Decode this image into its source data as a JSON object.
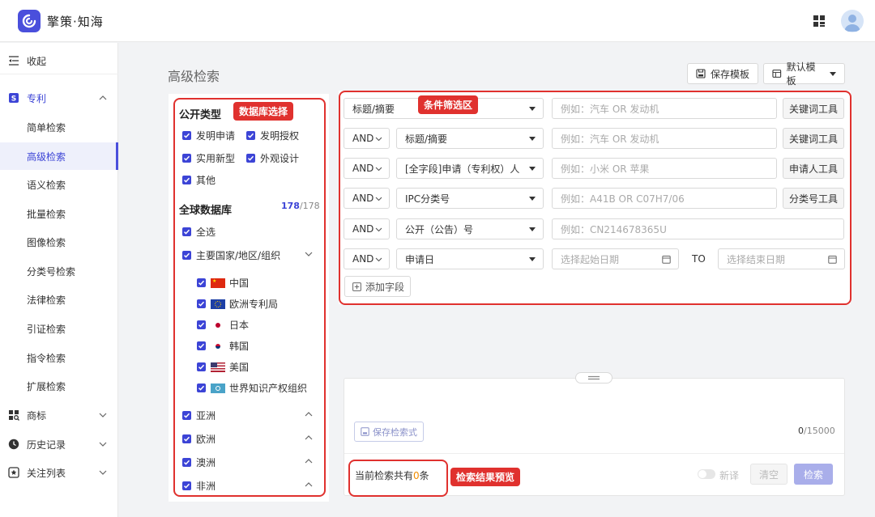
{
  "app": {
    "title": "擎策·知海"
  },
  "sidebar": {
    "collapse_label": "收起",
    "patent": {
      "label": "专利",
      "items": [
        "简单检索",
        "高级检索",
        "语义检索",
        "批量检索",
        "图像检索",
        "分类号检索",
        "法律检索",
        "引证检索",
        "指令检索",
        "扩展检索"
      ],
      "active": "高级检索"
    },
    "trademark_label": "商标",
    "history_label": "历史记录",
    "watchlist_label": "关注列表"
  },
  "page": {
    "title": "高级检索",
    "save_template_label": "保存模板",
    "default_template_label": "默认模板"
  },
  "database": {
    "pub_type_title": "公开类型",
    "pub_types": [
      "发明申请",
      "发明授权",
      "实用新型",
      "外观设计",
      "其他"
    ],
    "global_db_title": "全球数据库",
    "count_selected": "178",
    "count_total": "/178",
    "select_all_label": "全选",
    "major_group_label": "主要国家/地区/组织",
    "countries": [
      "中国",
      "欧洲专利局",
      "日本",
      "韩国",
      "美国",
      "世界知识产权组织"
    ],
    "regions": [
      "亚洲",
      "欧洲",
      "澳洲",
      "非洲"
    ]
  },
  "conditions": {
    "rows": [
      {
        "op": "",
        "field": "标题/摘要",
        "placeholder": "例如：汽车  OR 发动机",
        "tool": "关键词工具"
      },
      {
        "op": "AND",
        "field": "标题/摘要",
        "placeholder": "例如：汽车  OR 发动机",
        "tool": "关键词工具"
      },
      {
        "op": "AND",
        "field": "[全字段]申请（专利权）人",
        "placeholder": "例如：小米 OR 苹果",
        "tool": "申请人工具"
      },
      {
        "op": "AND",
        "field": "IPC分类号",
        "placeholder": "例如：A41B OR  C07H7/06",
        "tool": "分类号工具"
      },
      {
        "op": "AND",
        "field": "公开（公告）号",
        "placeholder": "例如：CN214678365U",
        "tool": ""
      },
      {
        "op": "AND",
        "field": "申请日",
        "placeholder": "选择起始日期",
        "placeholder_end": "选择结束日期",
        "to": "TO",
        "tool": ""
      }
    ],
    "add_field_label": "添加字段"
  },
  "query": {
    "save_expr_label": "保存检索式",
    "char_count": "0",
    "char_limit": "/15000",
    "result_prefix": "当前检索共有",
    "result_count": "0",
    "result_suffix": "条",
    "new_translate_label": "新译",
    "clear_label": "清空",
    "search_label": "检索"
  },
  "annotations": {
    "db_select": "数据库选择",
    "condition_filter": "条件筛选区",
    "result_preview": "检索结果预览"
  },
  "colors": {
    "accent": "#3c44d6",
    "annotation_red": "#e0312e",
    "search_button": "#a9aeea"
  }
}
